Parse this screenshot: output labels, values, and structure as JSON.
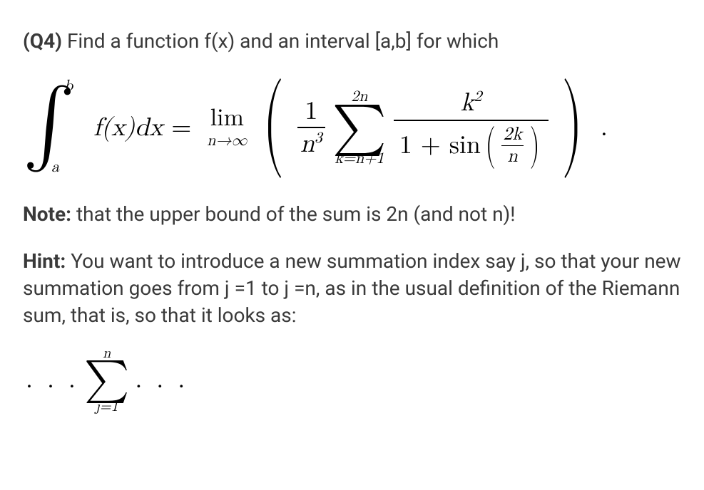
{
  "q": {
    "label": "(Q4)",
    "prompt": "Find a function f(x) and an interval [a,b] for which"
  },
  "formula1": {
    "int_lower": "a",
    "int_upper": "b",
    "integrand": "f(x)dx",
    "eq": "=",
    "lim_text": "lim",
    "lim_sub": "n→∞",
    "paren_l": "(",
    "paren_r": ")",
    "frac_num": "1",
    "frac_den_n": "n",
    "frac_den_exp": "3",
    "sigma_upper": "2n",
    "sigma_lower": "k=n+1",
    "big_num_k": "k",
    "big_num_exp": "2",
    "big_den_1plus": "1 + sin",
    "inner_num": "2k",
    "inner_den": "n",
    "dot": "."
  },
  "note": {
    "label": "Note:",
    "text": "that the upper bound of the sum is 2n (and not n)!"
  },
  "hint": {
    "label": "Hint:",
    "text": "You want to introduce a new summation index say j, so that your new summation goes from j =1 to j =n, as in the usual definition of the Riemann sum, that is, so that it looks as:"
  },
  "formula2": {
    "dots_l": ". . .",
    "sigma_upper": "n",
    "sigma_lower": "j=1",
    "dots_r": ". . ."
  }
}
